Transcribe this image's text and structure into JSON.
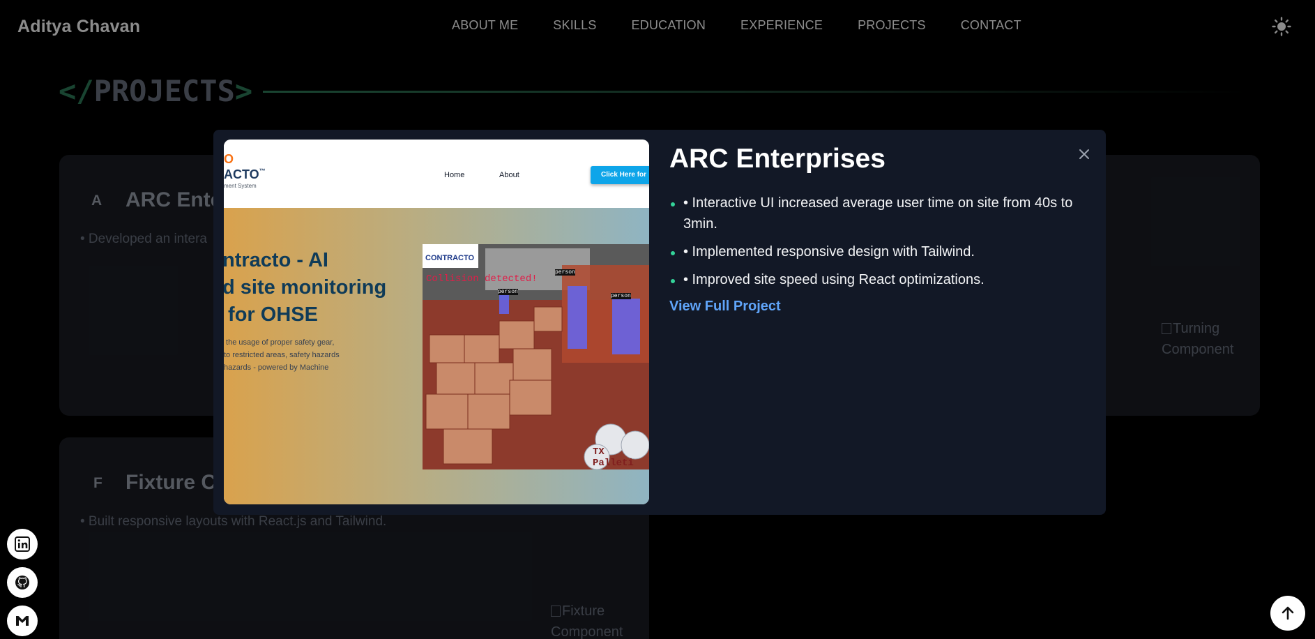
{
  "header": {
    "brand": "Aditya Chavan",
    "nav": [
      "ABOUT ME",
      "SKILLS",
      "EDUCATION",
      "EXPERIENCE",
      "PROJECTS",
      "CONTACT"
    ],
    "theme_icon": "sun-icon"
  },
  "section": {
    "title_open": "</",
    "title_text": "PROJECTS",
    "title_close": ">"
  },
  "cards": [
    {
      "letter": "A",
      "title": "ARC Ente",
      "bullet": "• Developed an intera",
      "image_alt_line1": "Turning",
      "image_alt_line2": "Component"
    },
    {
      "letter": "F",
      "title": "Fixture C",
      "bullet": "• Built responsive layouts with React.js and Tailwind.",
      "image_alt_line1": "Fixture",
      "image_alt_line2": "Component"
    }
  ],
  "modal": {
    "title": "ARC Enterprises",
    "bullets": [
      "• Interactive UI increased average user time on site from 40s to 3min.",
      "• Implemented responsive design with Tailwind.",
      "• Improved site speed using React optimizations."
    ],
    "link": "View Full Project",
    "close_icon": "close-icon",
    "preview": {
      "logo": "ACTO",
      "logo_tm": "™",
      "logo_sub": "ment System",
      "nav_home": "Home",
      "nav_about": "About",
      "cta": "Click Here for",
      "heading": "ntracto - AI\nd site monitoring\n for OHSE",
      "desc": " the usage of proper safety gear,\nto restricted areas, safety hazards\nhazards - powered by Machine",
      "photo_logo": "CONTRACTO",
      "detection": "Collision detected!",
      "pallet": "TX Palleti",
      "person_label": "person"
    }
  },
  "social": [
    "linkedin-icon",
    "github-icon",
    "gmail-icon"
  ],
  "scroll_top_icon": "arrow-up-icon"
}
